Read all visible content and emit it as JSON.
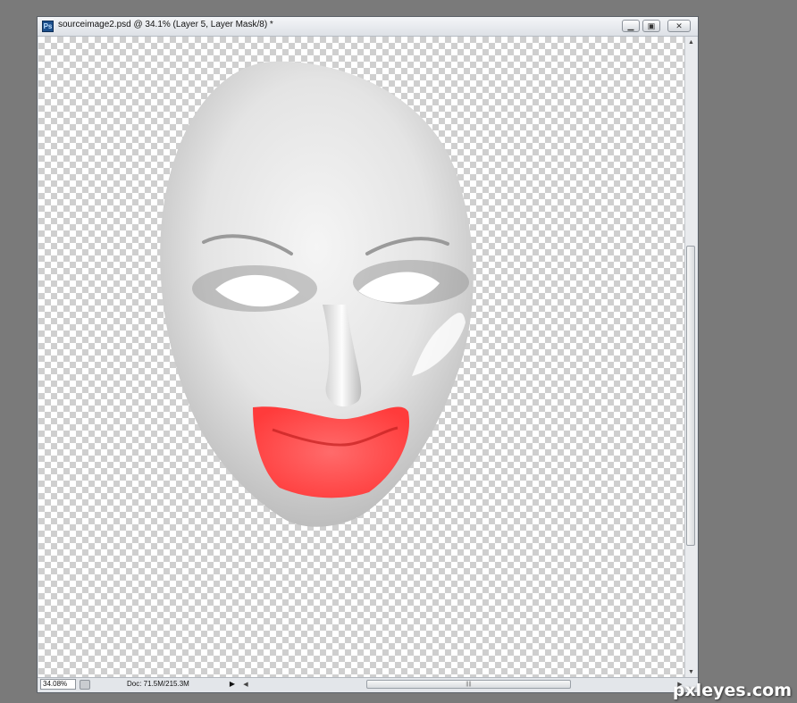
{
  "window": {
    "title": "sourceimage2.psd @ 34.1% (Layer 5, Layer Mask/8) *",
    "app_icon": "Ps",
    "buttons": {
      "minimize": "minimize-icon",
      "restore": "restore-icon",
      "close": "close-icon"
    }
  },
  "statusbar": {
    "zoom": "34.08%",
    "doc_info": "Doc: 71.5M/215.3M",
    "menu_arrow": "▶"
  },
  "scroll": {
    "up": "▲",
    "down": "▼",
    "left": "◀",
    "right": "▶",
    "grip": "||||"
  },
  "watermark": "pxleyes.com",
  "colors": {
    "app_background": "#7a7a7a",
    "lips": "#ff4a4a",
    "mask": "#e6e6e6"
  }
}
